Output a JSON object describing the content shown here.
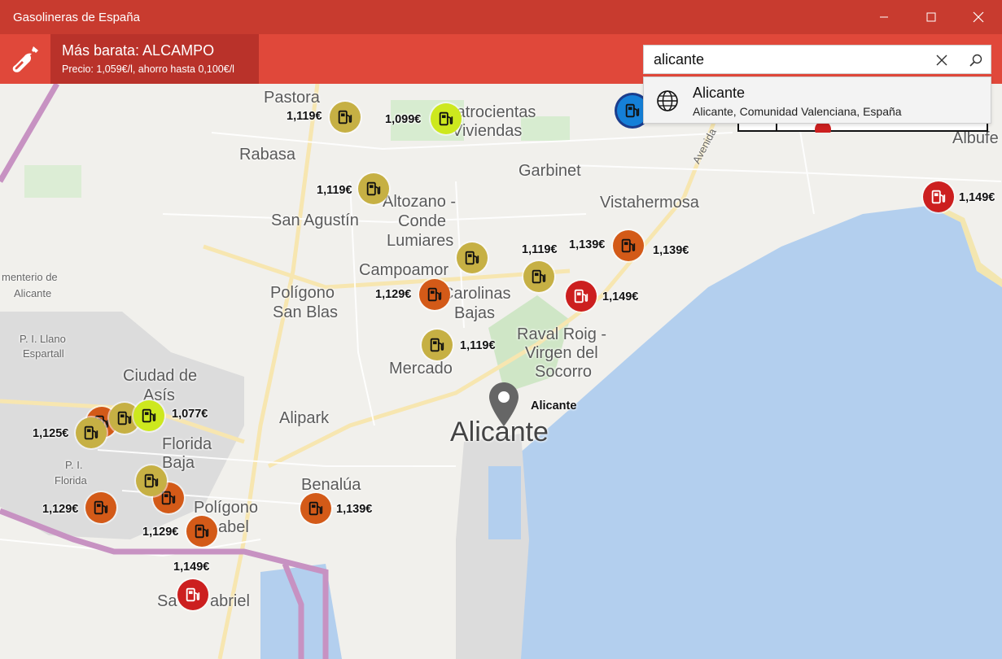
{
  "window": {
    "title": "Gasolineras de España"
  },
  "header": {
    "cheapest_title": "Más barata: ALCAMPO",
    "cheapest_detail": "Precio: 1,059€/l, ahorro hasta 0,100€/l"
  },
  "search": {
    "value": "alicante",
    "suggestion_title": "Alicante",
    "suggestion_subtitle": "Alicante, Comunidad Valenciana, España"
  },
  "map": {
    "labels": [
      "Pastora",
      "Cuatrocientas",
      "Viviendas",
      "Rabasa",
      "Garbinet",
      "Avenida",
      "Albufe",
      "Altozano -",
      "Conde",
      "Lumiares",
      "Vistahermosa",
      "San Agustín",
      "Campoamor",
      "Carolinas",
      "Bajas",
      "Polígono",
      "San Blas",
      "Raval Roig -",
      "Virgen del",
      "Socorro",
      "Mercado",
      "Ciudad de",
      "Asís",
      "Alipark",
      "Florida",
      "Baja",
      "Benalúa",
      "Polígono",
      "abel",
      "Sa",
      "abriel",
      "menterio de",
      "Alicante",
      "P. I. Llano",
      "Espartall",
      "P. I.",
      "Florida"
    ],
    "city_label": "Alicante",
    "pin_label": "Alicante"
  },
  "stations": [
    {
      "price": "1,119€",
      "color": "olive"
    },
    {
      "price": "1,099€",
      "color": "lime"
    },
    {
      "price": "",
      "color": "blue"
    },
    {
      "price": "1,119€",
      "color": "olive"
    },
    {
      "price": "1,149€",
      "color": "red"
    },
    {
      "price": "1,119€",
      "color": "olive"
    },
    {
      "price": "1,139€",
      "color": "orange"
    },
    {
      "price": "1,139€",
      "color": "orange"
    },
    {
      "price": "1,129€",
      "color": "orange"
    },
    {
      "price": "1,149€",
      "color": "red"
    },
    {
      "price": "1,119€",
      "color": "olive"
    },
    {
      "price": "1,077€",
      "color": "lime"
    },
    {
      "price": "1,125€",
      "color": "olive"
    },
    {
      "price": "1,129€",
      "color": "orange"
    },
    {
      "price": "1,129€",
      "color": "orange"
    },
    {
      "price": "1,139€",
      "color": "orange"
    },
    {
      "price": "1,149€",
      "color": "red"
    }
  ],
  "colors": {
    "titlebar": "#c83b2f",
    "header": "#e0483a",
    "cheapest_panel": "#b9322a",
    "water": "#b3cfee"
  },
  "icons": [
    "fuel-pump-logo-icon",
    "minimize-icon",
    "maximize-icon",
    "close-icon",
    "clear-icon",
    "search-icon",
    "globe-icon",
    "map-pin-icon",
    "fuel-station-icon"
  ]
}
